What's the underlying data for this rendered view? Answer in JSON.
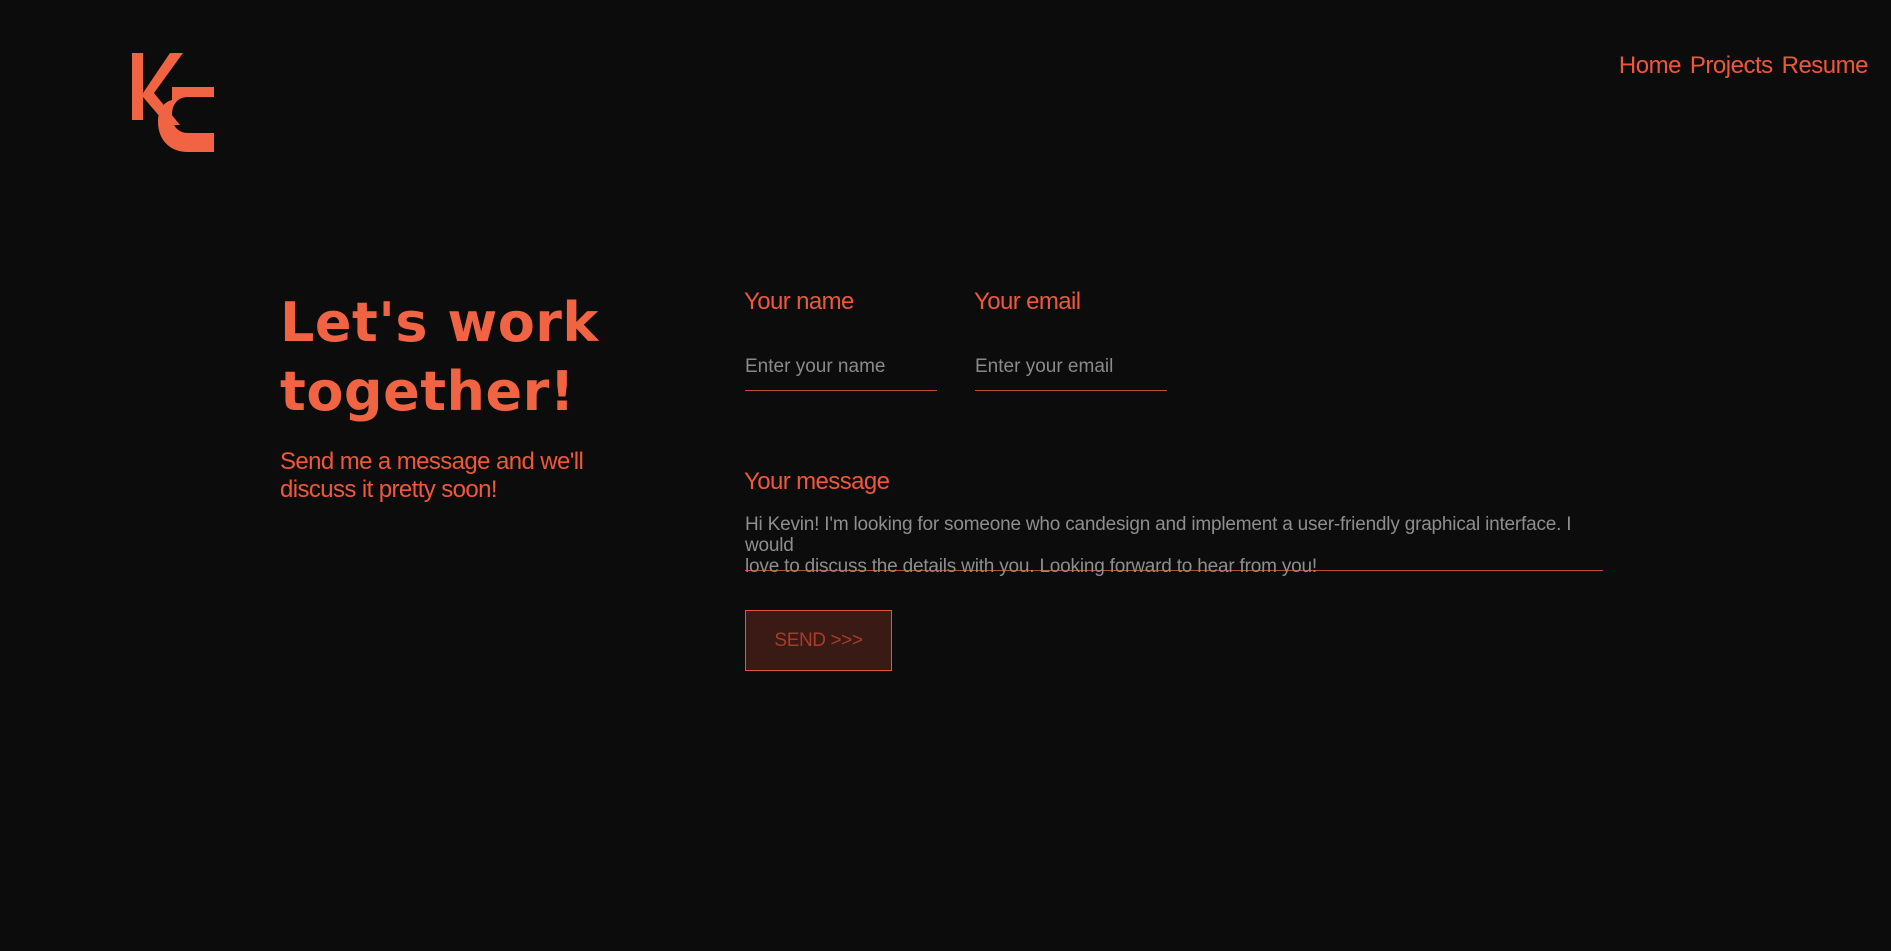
{
  "brand": {
    "logo_text": "KC",
    "color": "#f0573a"
  },
  "nav": {
    "items": [
      {
        "label": "Home"
      },
      {
        "label": "Projects"
      },
      {
        "label": "Resume"
      }
    ]
  },
  "intro": {
    "headline_line1": "Let's work",
    "headline_line2": "together!",
    "subline_line1": "Send me a message and we'll",
    "subline_line2": "discuss it pretty soon!"
  },
  "form": {
    "name": {
      "label": "Your name",
      "placeholder": "Enter your name",
      "value": ""
    },
    "email": {
      "label": "Your email",
      "placeholder": "Enter your email",
      "value": ""
    },
    "message": {
      "label": "Your message",
      "value_line1": "Hi Kevin! I'm looking for someone who candesign and implement a user-friendly graphical interface. I would",
      "value_line2": "love to discuss the details with you. Looking forward to hear from you!"
    },
    "send_label": "SEND >>>"
  },
  "colors": {
    "background": "#0c0c0d",
    "accent": "#f0573a",
    "button_bg": "#3a1a14",
    "placeholder": "#8a8a8a"
  }
}
